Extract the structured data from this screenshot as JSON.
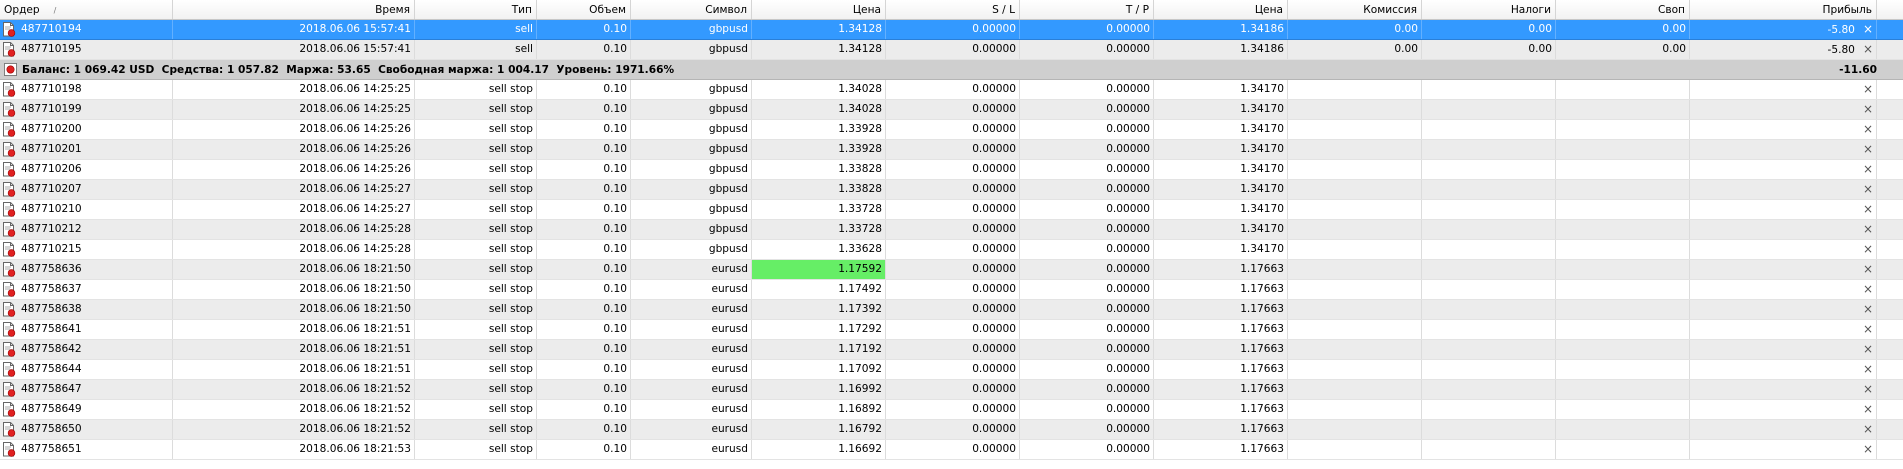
{
  "columns": {
    "order": "Ордер",
    "time": "Время",
    "type": "Тип",
    "volume": "Объем",
    "symbol": "Символ",
    "price": "Цена",
    "sl": "S / L",
    "tp": "T / P",
    "price2": "Цена",
    "commission": "Комиссия",
    "taxes": "Налоги",
    "swap": "Своп",
    "profit": "Прибыль"
  },
  "sort_indicator": "/",
  "open_positions": [
    {
      "order": "487710194",
      "time": "2018.06.06 15:57:41",
      "type": "sell",
      "volume": "0.10",
      "symbol": "gbpusd",
      "price": "1.34128",
      "sl": "0.00000",
      "tp": "0.00000",
      "price2": "1.34186",
      "commission": "0.00",
      "taxes": "0.00",
      "swap": "0.00",
      "profit": "-5.80"
    },
    {
      "order": "487710195",
      "time": "2018.06.06 15:57:41",
      "type": "sell",
      "volume": "0.10",
      "symbol": "gbpusd",
      "price": "1.34128",
      "sl": "0.00000",
      "tp": "0.00000",
      "price2": "1.34186",
      "commission": "0.00",
      "taxes": "0.00",
      "swap": "0.00",
      "profit": "-5.80"
    }
  ],
  "balance": {
    "text": "Баланс: 1 069.42 USD  Средства: 1 057.82  Маржа: 53.65  Свободная маржа: 1 004.17  Уровень: 1971.66%",
    "profit": "-11.60"
  },
  "pending_orders": [
    {
      "order": "487710198",
      "time": "2018.06.06 14:25:25",
      "type": "sell stop",
      "volume": "0.10",
      "symbol": "gbpusd",
      "price": "1.34028",
      "sl": "0.00000",
      "tp": "0.00000",
      "price2": "1.34170"
    },
    {
      "order": "487710199",
      "time": "2018.06.06 14:25:25",
      "type": "sell stop",
      "volume": "0.10",
      "symbol": "gbpusd",
      "price": "1.34028",
      "sl": "0.00000",
      "tp": "0.00000",
      "price2": "1.34170"
    },
    {
      "order": "487710200",
      "time": "2018.06.06 14:25:26",
      "type": "sell stop",
      "volume": "0.10",
      "symbol": "gbpusd",
      "price": "1.33928",
      "sl": "0.00000",
      "tp": "0.00000",
      "price2": "1.34170"
    },
    {
      "order": "487710201",
      "time": "2018.06.06 14:25:26",
      "type": "sell stop",
      "volume": "0.10",
      "symbol": "gbpusd",
      "price": "1.33928",
      "sl": "0.00000",
      "tp": "0.00000",
      "price2": "1.34170"
    },
    {
      "order": "487710206",
      "time": "2018.06.06 14:25:26",
      "type": "sell stop",
      "volume": "0.10",
      "symbol": "gbpusd",
      "price": "1.33828",
      "sl": "0.00000",
      "tp": "0.00000",
      "price2": "1.34170"
    },
    {
      "order": "487710207",
      "time": "2018.06.06 14:25:27",
      "type": "sell stop",
      "volume": "0.10",
      "symbol": "gbpusd",
      "price": "1.33828",
      "sl": "0.00000",
      "tp": "0.00000",
      "price2": "1.34170"
    },
    {
      "order": "487710210",
      "time": "2018.06.06 14:25:27",
      "type": "sell stop",
      "volume": "0.10",
      "symbol": "gbpusd",
      "price": "1.33728",
      "sl": "0.00000",
      "tp": "0.00000",
      "price2": "1.34170"
    },
    {
      "order": "487710212",
      "time": "2018.06.06 14:25:28",
      "type": "sell stop",
      "volume": "0.10",
      "symbol": "gbpusd",
      "price": "1.33728",
      "sl": "0.00000",
      "tp": "0.00000",
      "price2": "1.34170"
    },
    {
      "order": "487710215",
      "time": "2018.06.06 14:25:28",
      "type": "sell stop",
      "volume": "0.10",
      "symbol": "gbpusd",
      "price": "1.33628",
      "sl": "0.00000",
      "tp": "0.00000",
      "price2": "1.34170"
    },
    {
      "order": "487758636",
      "time": "2018.06.06 18:21:50",
      "type": "sell stop",
      "volume": "0.10",
      "symbol": "eurusd",
      "price": "1.17592",
      "sl": "0.00000",
      "tp": "0.00000",
      "price2": "1.17663",
      "highlight": true
    },
    {
      "order": "487758637",
      "time": "2018.06.06 18:21:50",
      "type": "sell stop",
      "volume": "0.10",
      "symbol": "eurusd",
      "price": "1.17492",
      "sl": "0.00000",
      "tp": "0.00000",
      "price2": "1.17663"
    },
    {
      "order": "487758638",
      "time": "2018.06.06 18:21:50",
      "type": "sell stop",
      "volume": "0.10",
      "symbol": "eurusd",
      "price": "1.17392",
      "sl": "0.00000",
      "tp": "0.00000",
      "price2": "1.17663"
    },
    {
      "order": "487758641",
      "time": "2018.06.06 18:21:51",
      "type": "sell stop",
      "volume": "0.10",
      "symbol": "eurusd",
      "price": "1.17292",
      "sl": "0.00000",
      "tp": "0.00000",
      "price2": "1.17663"
    },
    {
      "order": "487758642",
      "time": "2018.06.06 18:21:51",
      "type": "sell stop",
      "volume": "0.10",
      "symbol": "eurusd",
      "price": "1.17192",
      "sl": "0.00000",
      "tp": "0.00000",
      "price2": "1.17663"
    },
    {
      "order": "487758644",
      "time": "2018.06.06 18:21:51",
      "type": "sell stop",
      "volume": "0.10",
      "symbol": "eurusd",
      "price": "1.17092",
      "sl": "0.00000",
      "tp": "0.00000",
      "price2": "1.17663"
    },
    {
      "order": "487758647",
      "time": "2018.06.06 18:21:52",
      "type": "sell stop",
      "volume": "0.10",
      "symbol": "eurusd",
      "price": "1.16992",
      "sl": "0.00000",
      "tp": "0.00000",
      "price2": "1.17663"
    },
    {
      "order": "487758649",
      "time": "2018.06.06 18:21:52",
      "type": "sell stop",
      "volume": "0.10",
      "symbol": "eurusd",
      "price": "1.16892",
      "sl": "0.00000",
      "tp": "0.00000",
      "price2": "1.17663"
    },
    {
      "order": "487758650",
      "time": "2018.06.06 18:21:52",
      "type": "sell stop",
      "volume": "0.10",
      "symbol": "eurusd",
      "price": "1.16792",
      "sl": "0.00000",
      "tp": "0.00000",
      "price2": "1.17663"
    },
    {
      "order": "487758651",
      "time": "2018.06.06 18:21:53",
      "type": "sell stop",
      "volume": "0.10",
      "symbol": "eurusd",
      "price": "1.16692",
      "sl": "0.00000",
      "tp": "0.00000",
      "price2": "1.17663"
    }
  ],
  "close_glyph": "×",
  "colors": {
    "selected_row": "#3399ff",
    "price_highlight": "#66ee66",
    "balance_bar": "#cfcfcf",
    "alt_row": "#ececec",
    "order_icon_dot": "#e02020"
  },
  "icons": {
    "order_row": "document-order-icon",
    "balance_row": "balance-circle-icon",
    "close": "close-icon"
  }
}
